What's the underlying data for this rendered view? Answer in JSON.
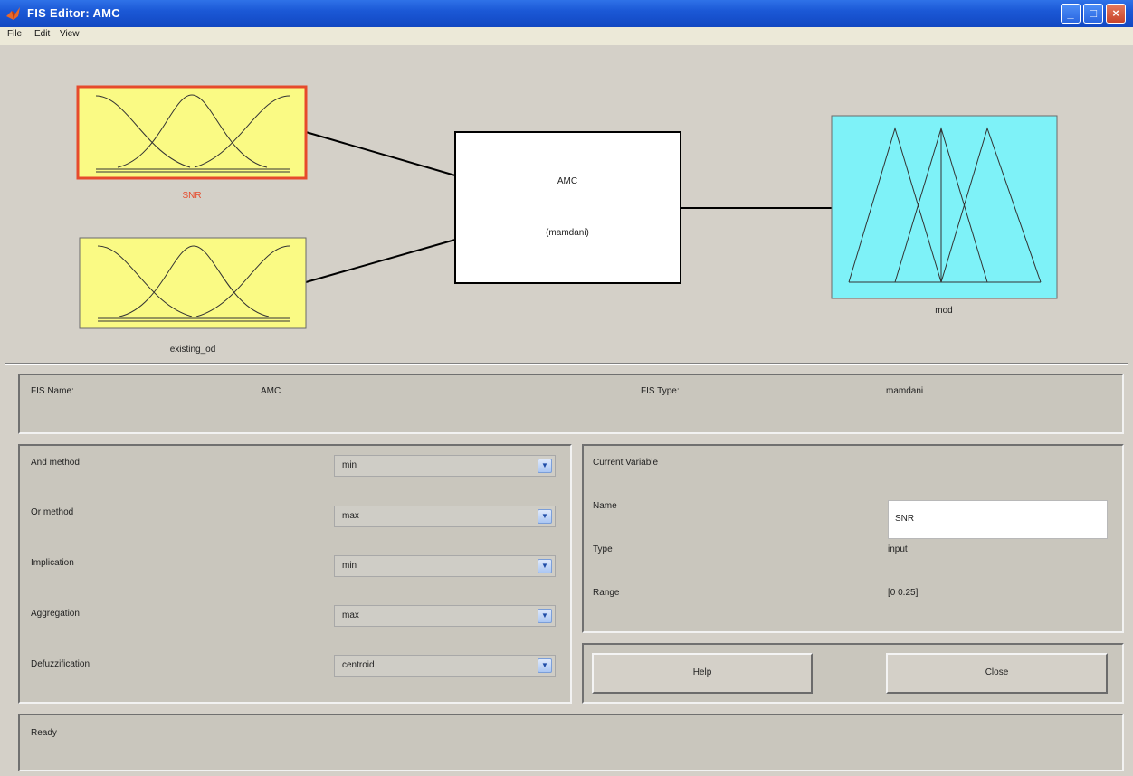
{
  "window": {
    "title": "FIS Editor: AMC",
    "minimize": "_",
    "maximize": "□",
    "close": "×"
  },
  "menu": {
    "items": [
      "File",
      "Edit",
      "View"
    ]
  },
  "diagram": {
    "inputs": [
      {
        "label": "SNR",
        "selected": true
      },
      {
        "label": "existing_od",
        "selected": false
      }
    ],
    "system": {
      "name": "AMC",
      "type": "(mamdani)"
    },
    "output": {
      "label": "mod"
    }
  },
  "fis": {
    "name_label": "FIS Name:",
    "name_value": "AMC",
    "type_label": "FIS Type:",
    "type_value": "mamdani"
  },
  "methods": [
    {
      "label": "And method",
      "value": "min"
    },
    {
      "label": "Or method",
      "value": "max"
    },
    {
      "label": "Implication",
      "value": "min"
    },
    {
      "label": "Aggregation",
      "value": "max"
    },
    {
      "label": "Defuzzification",
      "value": "centroid"
    }
  ],
  "current_variable": {
    "title": "Current Variable",
    "name_label": "Name",
    "name_value": "SNR",
    "type_label": "Type",
    "type_value": "input",
    "range_label": "Range",
    "range_value": "[0 0.25]"
  },
  "buttons": {
    "help": "Help",
    "close": "Close"
  },
  "status": {
    "text": "Ready"
  },
  "colors": {
    "input_box": "#fafa84",
    "output_box": "#7ef2f8",
    "selected_border": "#e64a2c",
    "title_bar": "#1b58d6"
  }
}
